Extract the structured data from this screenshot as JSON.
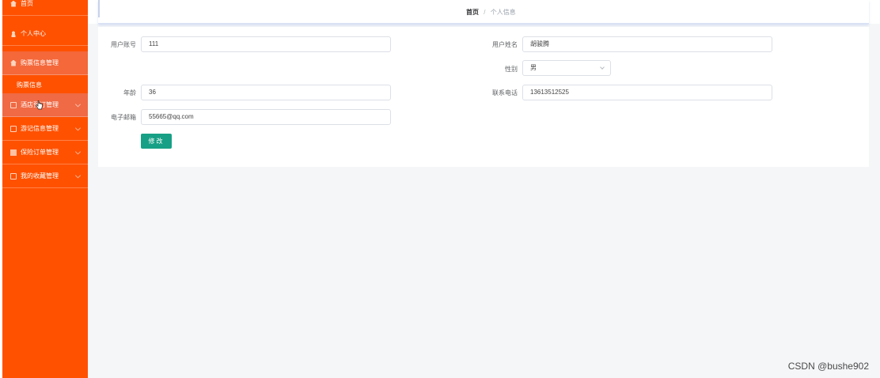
{
  "sidebar": {
    "items": [
      {
        "label": "首页",
        "icon": "home-icon"
      },
      {
        "label": "个人中心",
        "icon": "user-icon"
      },
      {
        "label": "购票信息管理",
        "icon": "ticket-icon"
      },
      {
        "label": "酒店预订管理",
        "icon": "hotel-icon"
      },
      {
        "label": "游记信息管理",
        "icon": "note-icon"
      },
      {
        "label": "保险订单管理",
        "icon": "insurance-icon"
      },
      {
        "label": "我的收藏管理",
        "icon": "favorite-icon"
      }
    ],
    "submenu": {
      "label": "购票信息"
    },
    "bg_color": "#ff5100"
  },
  "breadcrumb": {
    "home": "首页",
    "separator": "/",
    "current": "个人信息"
  },
  "form": {
    "account_label": "用户账号",
    "account_value": "111",
    "name_label": "用户姓名",
    "name_value": "胡骏腾",
    "gender_label": "性别",
    "gender_value": "男",
    "age_label": "年龄",
    "age_value": "36",
    "phone_label": "联系电话",
    "phone_value": "13613512525",
    "email_label": "电子邮箱",
    "email_value": "55665@qq.com",
    "submit_label": "修改",
    "button_color": "#17a085"
  },
  "watermark": "CSDN @bushe902"
}
